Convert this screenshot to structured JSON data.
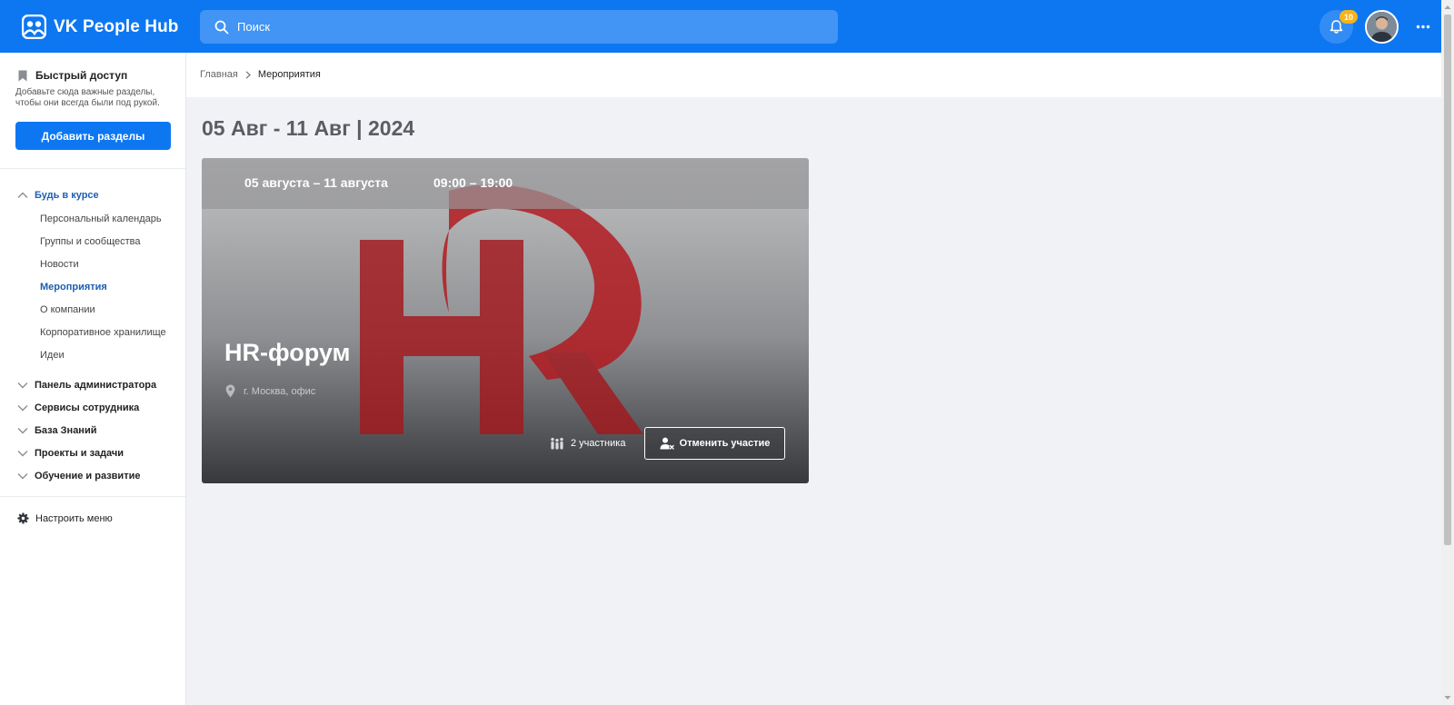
{
  "app": {
    "title": "VK People Hub"
  },
  "search": {
    "placeholder": "Поиск"
  },
  "notifications": {
    "count": "10"
  },
  "sidebar": {
    "quick_access": {
      "title": "Быстрый доступ",
      "description": "Добавьте сюда важные разделы, чтобы они всегда были под рукой.",
      "button": "Добавить разделы"
    },
    "groups": [
      {
        "label": "Будь в курсе",
        "expanded": true,
        "items": [
          {
            "label": "Персональный календарь"
          },
          {
            "label": "Группы и сообщества"
          },
          {
            "label": "Новости"
          },
          {
            "label": "Мероприятия",
            "active": true
          },
          {
            "label": "О компании"
          },
          {
            "label": "Корпоративное хранилище"
          },
          {
            "label": "Идеи"
          }
        ]
      },
      {
        "label": "Панель администратора",
        "expanded": false
      },
      {
        "label": "Сервисы сотрудника",
        "expanded": false
      },
      {
        "label": "База Знаний",
        "expanded": false
      },
      {
        "label": "Проекты и задачи",
        "expanded": false
      },
      {
        "label": "Обучение и развитие",
        "expanded": false
      }
    ],
    "setup_menu": "Настроить меню"
  },
  "breadcrumb": {
    "home": "Главная",
    "current": "Мероприятия"
  },
  "week_title": "05 Авг - 11 Авг | 2024",
  "event": {
    "dates": "05 августа – 11 августа",
    "time": "09:00 – 19:00",
    "title": "HR-форум",
    "location": "г. Москва, офис",
    "participants": "2 участника",
    "cancel_label": "Отменить участие",
    "logo_letters": "HR"
  },
  "colors": {
    "primary": "#0d77f2",
    "active_link": "#1e5fb3",
    "badge": "#f5b31c",
    "logo_red": "#b3161c"
  },
  "icons": {
    "brand": "people-hub-logo-icon",
    "search": "search-icon",
    "bell": "bell-icon",
    "more": "more-icon",
    "bookmark": "bookmark-icon",
    "chevron": "chevron-icon",
    "gear": "gear-icon",
    "location": "location-pin-icon",
    "participants": "participants-icon",
    "cancel": "user-remove-icon"
  }
}
